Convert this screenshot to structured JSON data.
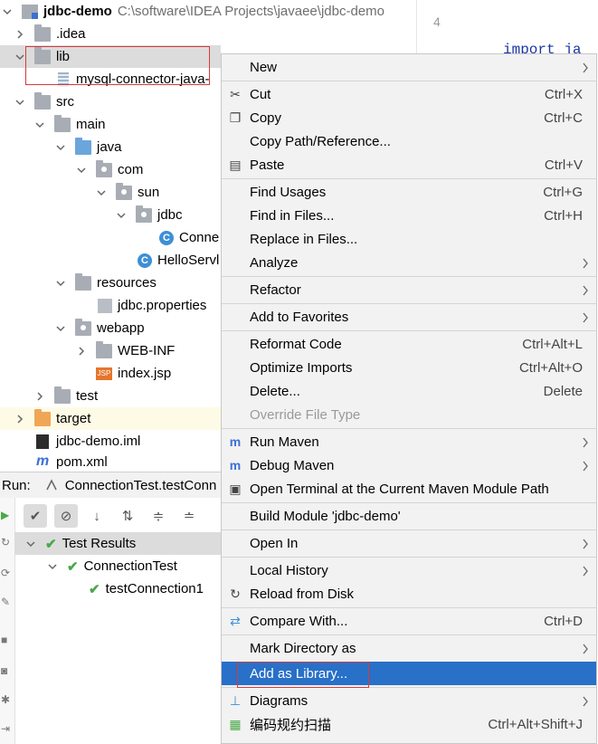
{
  "project_tree": {
    "root": {
      "name": "jdbc-demo",
      "path": "C:\\software\\IDEA Projects\\javaee\\jdbc-demo"
    },
    "items": [
      {
        "label": ".idea"
      },
      {
        "label": "lib"
      },
      {
        "label": "mysql-connector-java-"
      },
      {
        "label": "src"
      },
      {
        "label": "main"
      },
      {
        "label": "java"
      },
      {
        "label": "com"
      },
      {
        "label": "sun"
      },
      {
        "label": "jdbc"
      },
      {
        "label": "Conne"
      },
      {
        "label": "HelloServl"
      },
      {
        "label": "resources"
      },
      {
        "label": "jdbc.properties"
      },
      {
        "label": "webapp"
      },
      {
        "label": "WEB-INF"
      },
      {
        "label": "index.jsp"
      },
      {
        "label": "test"
      },
      {
        "label": "target"
      },
      {
        "label": "jdbc-demo.iml"
      },
      {
        "label": "pom.xml"
      }
    ],
    "icon_texts": {
      "class": "C",
      "jsp": "JSP"
    }
  },
  "editor": {
    "line_number": "4",
    "code": "import ja"
  },
  "run_panel": {
    "label": "Run:",
    "tab": "ConnectionTest.testConn",
    "results": [
      {
        "label": "Test Results"
      },
      {
        "label": "ConnectionTest"
      },
      {
        "label": "testConnection1"
      }
    ]
  },
  "context_menu": {
    "items": [
      {
        "label": "New"
      },
      {
        "label": "Cut",
        "shortcut": "Ctrl+X"
      },
      {
        "label": "Copy",
        "shortcut": "Ctrl+C"
      },
      {
        "label": "Copy Path/Reference..."
      },
      {
        "label": "Paste",
        "shortcut": "Ctrl+V"
      },
      {
        "label": "Find Usages",
        "shortcut": "Ctrl+G"
      },
      {
        "label": "Find in Files...",
        "shortcut": "Ctrl+H"
      },
      {
        "label": "Replace in Files..."
      },
      {
        "label": "Analyze"
      },
      {
        "label": "Refactor"
      },
      {
        "label": "Add to Favorites"
      },
      {
        "label": "Reformat Code",
        "shortcut": "Ctrl+Alt+L"
      },
      {
        "label": "Optimize Imports",
        "shortcut": "Ctrl+Alt+O"
      },
      {
        "label": "Delete...",
        "shortcut": "Delete"
      },
      {
        "label": "Override File Type"
      },
      {
        "label": "Run Maven"
      },
      {
        "label": "Debug Maven"
      },
      {
        "label": "Open Terminal at the Current Maven Module Path"
      },
      {
        "label": "Build Module 'jdbc-demo'"
      },
      {
        "label": "Open In"
      },
      {
        "label": "Local History"
      },
      {
        "label": "Reload from Disk"
      },
      {
        "label": "Compare With...",
        "shortcut": "Ctrl+D"
      },
      {
        "label": "Mark Directory as"
      },
      {
        "label": "Add as Library..."
      },
      {
        "label": "Diagrams"
      },
      {
        "label": "编码规约扫描",
        "shortcut": "Ctrl+Alt+Shift+J"
      }
    ]
  },
  "colors": {
    "selection": "#2870c8",
    "annotation_box": "#d63b3b",
    "menu_bg": "#f2f2f2"
  }
}
